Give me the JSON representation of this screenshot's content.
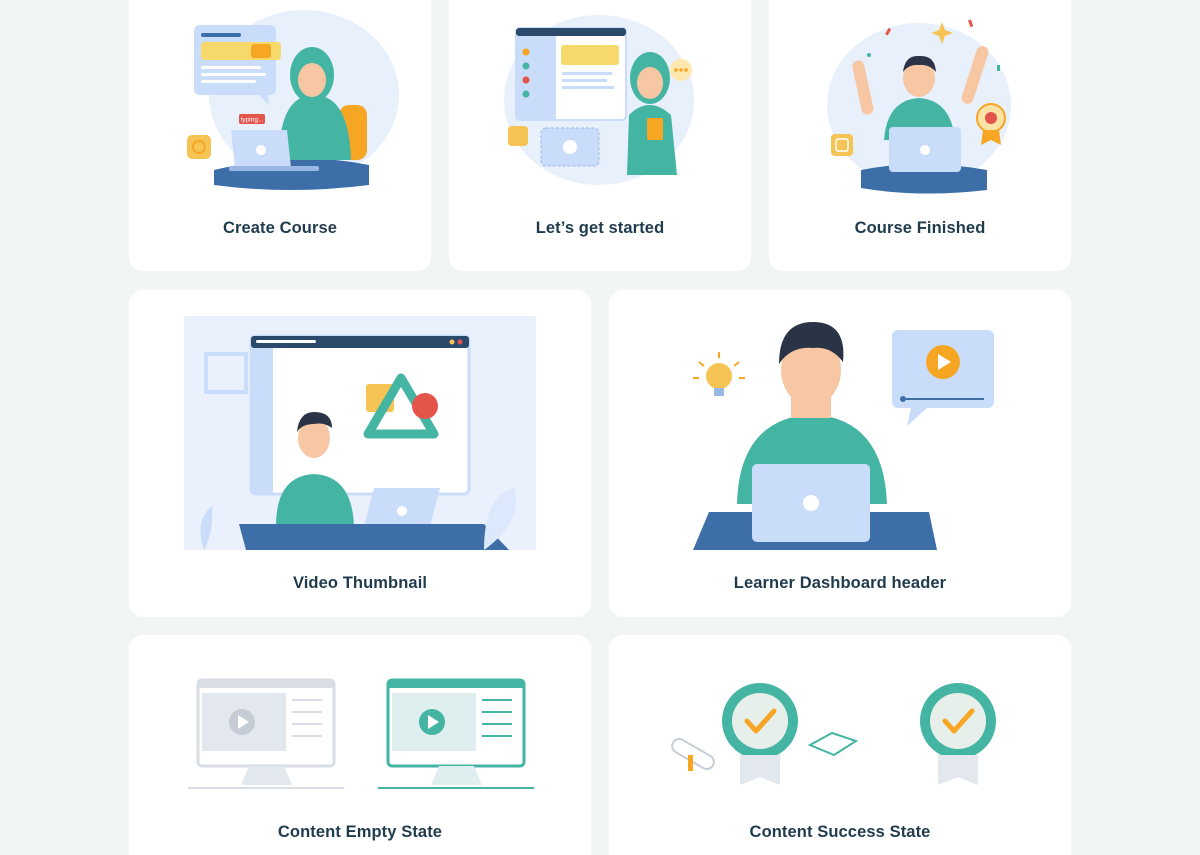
{
  "cards": [
    {
      "title": "Create Course",
      "badge": "typing..."
    },
    {
      "title": "Let’s get started"
    },
    {
      "title": "Course Finished"
    },
    {
      "title": "Video Thumbnail"
    },
    {
      "title": "Learner Dashboard header"
    },
    {
      "title": "Content Empty State"
    },
    {
      "title": "Content Success State"
    }
  ],
  "colors": {
    "background": "#f2f5f6",
    "card": "#ffffff",
    "title": "#1f3b4d",
    "teal": "#45b5a3",
    "navy": "#3d6ea8",
    "light_blue": "#c9ddfb",
    "orange": "#f6a623",
    "skin": "#f7c6a3",
    "hair": "#2b3446",
    "red": "#e5544b"
  }
}
